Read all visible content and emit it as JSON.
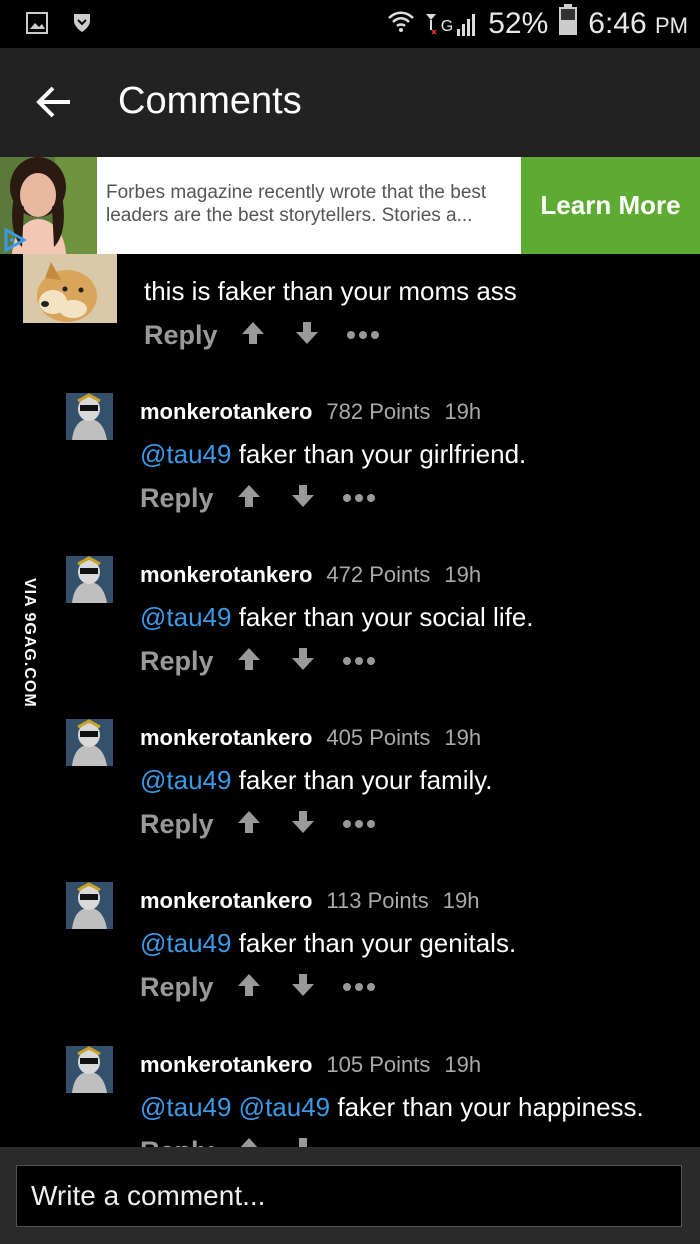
{
  "status_bar": {
    "battery": "52%",
    "time": "6:46",
    "ampm": "PM",
    "network": "G"
  },
  "header": {
    "title": "Comments"
  },
  "ad": {
    "text": "Forbes magazine recently wrote that the best leaders are the best storytellers. Stories a...",
    "cta": "Learn More"
  },
  "watermark": "VIA 9GAG.COM",
  "comments": [
    {
      "text": "this is faker than your moms ass",
      "reply": "Reply"
    },
    {
      "user": "monkerotankero",
      "points": "782 Points",
      "time": "19h",
      "mention": "@tau49",
      "text": " faker than your girlfriend.",
      "reply": "Reply"
    },
    {
      "user": "monkerotankero",
      "points": "472 Points",
      "time": "19h",
      "mention": "@tau49",
      "text": " faker than your social life.",
      "reply": "Reply"
    },
    {
      "user": "monkerotankero",
      "points": "405 Points",
      "time": "19h",
      "mention": "@tau49",
      "text": " faker than your family.",
      "reply": "Reply"
    },
    {
      "user": "monkerotankero",
      "points": "113 Points",
      "time": "19h",
      "mention": "@tau49",
      "text": " faker than your genitals.",
      "reply": "Reply"
    },
    {
      "user": "monkerotankero",
      "points": "105 Points",
      "time": "19h",
      "mention": "@tau49 @tau49",
      "text": " faker than your happiness.",
      "reply": "Reply"
    }
  ],
  "input": {
    "placeholder": "Write a comment..."
  }
}
